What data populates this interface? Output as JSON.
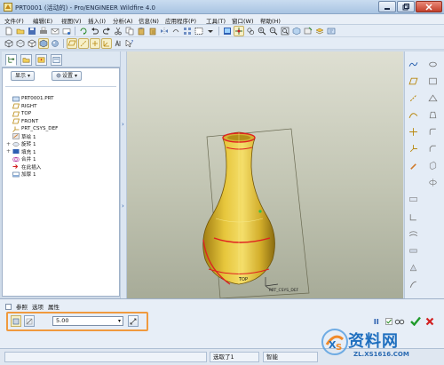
{
  "window": {
    "title": "PRT0001 (活动的) - Pro/ENGINEER Wildfire 4.0"
  },
  "menu": [
    "文件(F)",
    "编辑(E)",
    "视图(V)",
    "插入(I)",
    "分析(A)",
    "信息(N)",
    "应用程序(P)",
    "工具(T)",
    "窗口(W)",
    "帮助(H)"
  ],
  "panel": {
    "show_button": "显示",
    "settings_button": "设置",
    "tree": [
      {
        "label": "PRT0001.PRT",
        "icon": "part-icon",
        "expander": ""
      },
      {
        "label": "RIGHT",
        "icon": "datum-plane-icon",
        "expander": ""
      },
      {
        "label": "TOP",
        "icon": "datum-plane-icon",
        "expander": ""
      },
      {
        "label": "FRONT",
        "icon": "datum-plane-icon",
        "expander": ""
      },
      {
        "label": "PRT_CSYS_DEF",
        "icon": "csys-icon",
        "expander": ""
      },
      {
        "label": "草绘 1",
        "icon": "sketch-icon",
        "expander": ""
      },
      {
        "label": "旋转 1",
        "icon": "revolve-icon",
        "expander": "+"
      },
      {
        "label": "填充 1",
        "icon": "fill-icon",
        "expander": "+"
      },
      {
        "label": "合并 1",
        "icon": "merge-icon",
        "expander": ""
      },
      {
        "label": "在此插入",
        "icon": "insert-here-icon",
        "expander": ""
      },
      {
        "label": "加厚 1",
        "icon": "thicken-icon",
        "expander": ""
      }
    ]
  },
  "viewport": {
    "labels": {
      "top": "TOP",
      "csys": "PRT_CSYS_DEF"
    }
  },
  "dashboard": {
    "tabs": [
      "参照",
      "选项",
      "属性"
    ],
    "thickness_value": "5.00"
  },
  "status": {
    "selected": "选取了1",
    "filter": "智能"
  },
  "watermark": {
    "main": "资料网",
    "url": "ZL.XS1616.COM"
  },
  "colors": {
    "accent_orange": "#f09a3e",
    "vase_yellow": "#e8c83a",
    "highlight_red": "#e02020"
  }
}
